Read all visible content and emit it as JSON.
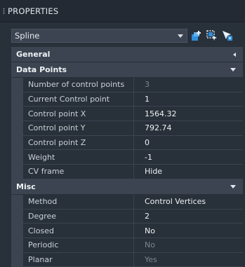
{
  "panel": {
    "title": "PROPERTIES"
  },
  "selector": {
    "value": "Spline"
  },
  "categories": {
    "general": "General",
    "data_points": "Data Points",
    "misc": "Misc"
  },
  "data_points": [
    {
      "name": "Number of control points",
      "value": "3"
    },
    {
      "name": "Current Control point",
      "value": "1"
    },
    {
      "name": "Control point X",
      "value": "1564.32"
    },
    {
      "name": "Control point Y",
      "value": "792.74"
    },
    {
      "name": "Control point Z",
      "value": "0"
    },
    {
      "name": "Weight",
      "value": "-1"
    },
    {
      "name": "CV frame",
      "value": "Hide"
    }
  ],
  "misc": [
    {
      "name": "Method",
      "value": "Control Vertices"
    },
    {
      "name": "Degree",
      "value": "2"
    },
    {
      "name": "Closed",
      "value": "No"
    },
    {
      "name": "Periodic",
      "value": "No"
    },
    {
      "name": "Planar",
      "value": "Yes"
    }
  ],
  "colors": {
    "panel_bg": "#283039",
    "header_bg": "#3b4450",
    "dim_text": "#7b8591",
    "icon_blue": "#2f8fdc"
  },
  "icons": [
    "grip-icon",
    "chevron-down-icon",
    "toggle-pickadd-icon",
    "select-objects-icon",
    "quick-select-icon"
  ]
}
